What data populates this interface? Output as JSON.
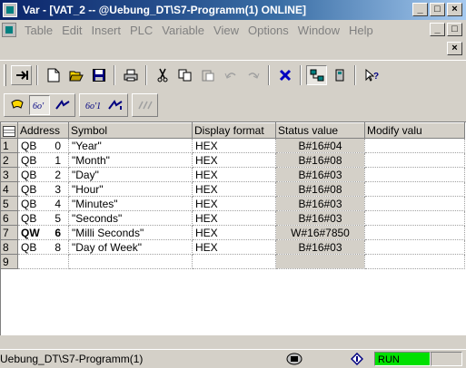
{
  "window": {
    "title": "Var - [VAT_2 -- @Uebung_DT\\S7-Programm(1)  ONLINE]",
    "minimize": "_",
    "maximize": "□",
    "close": "×"
  },
  "menu": {
    "items": [
      "Table",
      "Edit",
      "Insert",
      "PLC",
      "Variable",
      "View",
      "Options",
      "Window",
      "Help"
    ]
  },
  "icons": {
    "toolbar1": [
      "insert-row-icon",
      "new-icon",
      "open-icon",
      "save-icon",
      "print-icon",
      "cut-icon",
      "copy-icon",
      "paste-icon",
      "undo-icon",
      "redo-icon",
      "delete-icon",
      "accessible-nodes-icon",
      "connect-icon",
      "help-icon"
    ],
    "toolbar2": [
      "trigger-icon",
      "monitor-icon",
      "modify-icon",
      "monitor-once-icon",
      "modify-once-icon",
      "force-icon"
    ]
  },
  "grid": {
    "columns": [
      "",
      "Address",
      "Symbol",
      "Display format",
      "Status value",
      "Modify valu"
    ],
    "rows": [
      {
        "num": "1",
        "op": "QB",
        "addr": "0",
        "symbol": "\"Year\"",
        "format": "HEX",
        "status": "B#16#04",
        "modify": "",
        "bold": false
      },
      {
        "num": "2",
        "op": "QB",
        "addr": "1",
        "symbol": "\"Month\"",
        "format": "HEX",
        "status": "B#16#08",
        "modify": "",
        "bold": false
      },
      {
        "num": "3",
        "op": "QB",
        "addr": "2",
        "symbol": "\"Day\"",
        "format": "HEX",
        "status": "B#16#03",
        "modify": "",
        "bold": false
      },
      {
        "num": "4",
        "op": "QB",
        "addr": "3",
        "symbol": "\"Hour\"",
        "format": "HEX",
        "status": "B#16#08",
        "modify": "",
        "bold": false
      },
      {
        "num": "5",
        "op": "QB",
        "addr": "4",
        "symbol": "\"Minutes\"",
        "format": "HEX",
        "status": "B#16#03",
        "modify": "",
        "bold": false
      },
      {
        "num": "6",
        "op": "QB",
        "addr": "5",
        "symbol": "\"Seconds\"",
        "format": "HEX",
        "status": "B#16#03",
        "modify": "",
        "bold": false
      },
      {
        "num": "7",
        "op": "QW",
        "addr": "6",
        "symbol": "\"Milli Seconds\"",
        "format": "HEX",
        "status": "W#16#7850",
        "modify": "",
        "bold": true
      },
      {
        "num": "8",
        "op": "QB",
        "addr": "8",
        "symbol": "\"Day of Week\"",
        "format": "HEX",
        "status": "B#16#03",
        "modify": "",
        "bold": false
      },
      {
        "num": "9",
        "op": "",
        "addr": "",
        "symbol": "",
        "format": "",
        "status": "",
        "modify": "",
        "bold": false
      }
    ]
  },
  "statusbar": {
    "path": "Uebung_DT\\S7-Programm(1)",
    "mode": "RUN",
    "mode_color": "#00e000"
  },
  "colors": {
    "title_bar": "#0a246a",
    "chrome": "#d4d0c8"
  }
}
